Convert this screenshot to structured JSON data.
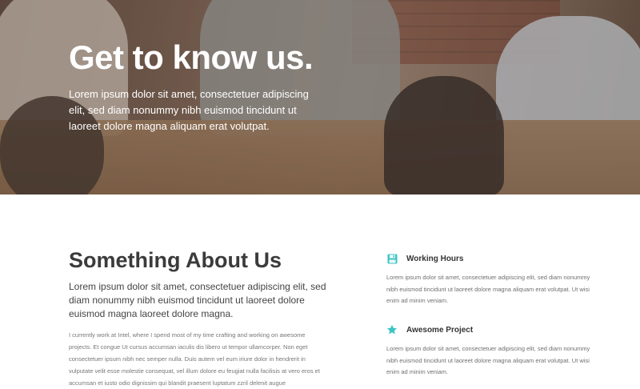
{
  "hero": {
    "title": "Get to know us.",
    "text": "Lorem ipsum dolor sit amet, consectetuer adipiscing elit, sed diam nonummy nibh euismod tincidunt ut laoreet dolore magna aliquam erat volutpat."
  },
  "about": {
    "title": "Something About Us",
    "lead": "Lorem ipsum dolor sit amet, consectetuer adipiscing elit, sed diam nonummy nibh euismod tincidunt ut laoreet dolore  euismod magna laoreet dolore magna.",
    "body": "I currently work at Intel, where I spend most of my time crafting and working on awesome projects. Et congue Ut cursus accumsan iaculis dis libero ut tempor ullamcorper. Non eget consectetuer ipsum nibh nec semper nulla. Duis autem vel eum iriure dolor in hendrerit in vulputate velit esse molestie consequat, vel illum dolore eu feugiat nulla facilisis at vero eros et accumsan et iusto odio dignissim qui blandit praesent luptatum zzril delenit augue"
  },
  "features": [
    {
      "icon": "floppy-disk-icon",
      "title": "Working Hours",
      "text": "Lorem ipsum dolor sit amet, consectetuer adipiscing elit, sed diam nonummy nibh euismod tincidunt ut laoreet dolore magna aliquam erat volutpat. Ut wisi enim ad minim veniam."
    },
    {
      "icon": "star-icon",
      "title": "Awesome Project",
      "text": "Lorem ipsum dolor sit amet, consectetuer adipiscing elit, sed diam nonummy nibh euismod tincidunt ut laoreet dolore magna aliquam erat volutpat. Ut wisi enim ad minim veniam."
    }
  ],
  "colors": {
    "accent": "#3cc4c4",
    "heading": "#3b3b3b",
    "text": "#6f6f6f"
  }
}
